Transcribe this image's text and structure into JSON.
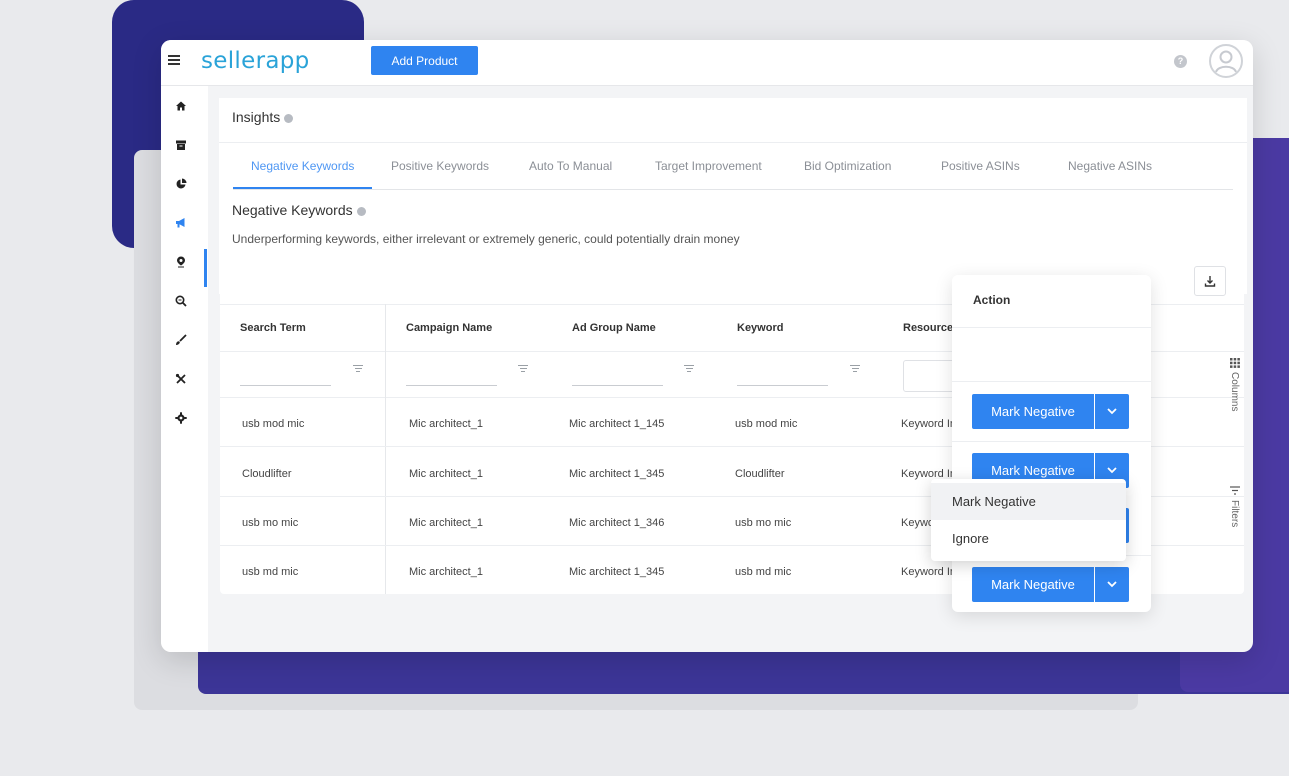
{
  "header": {
    "logo_text": "sellerapp",
    "add_product_label": "Add Product",
    "help_label": "?"
  },
  "sidebar": {
    "items": [
      {
        "icon": "home-icon",
        "glyph": "⌂"
      },
      {
        "icon": "archive-icon",
        "glyph": "▬"
      },
      {
        "icon": "pie-chart-icon",
        "glyph": "◕"
      },
      {
        "icon": "megaphone-icon",
        "glyph": "◢"
      },
      {
        "icon": "location-pin-icon",
        "glyph": "⚲"
      },
      {
        "icon": "search-icon",
        "glyph": "⊕"
      },
      {
        "icon": "brush-icon",
        "glyph": "✎"
      },
      {
        "icon": "tools-icon",
        "glyph": "✕"
      },
      {
        "icon": "settings-gear-icon",
        "glyph": "✹"
      }
    ],
    "active_index": 3
  },
  "insights": {
    "title": "Insights",
    "tabs": [
      "Negative Keywords",
      "Positive Keywords",
      "Auto To Manual",
      "Target Improvement",
      "Bid Optimization",
      "Positive ASINs",
      "Negative ASINs"
    ],
    "active_tab": 0,
    "section_title": "Negative Keywords",
    "section_description": "Underperforming keywords, either irrelevant or extremely generic, could potentially drain money"
  },
  "table": {
    "columns": [
      "Search Term",
      "Campaign Name",
      "Ad Group Name",
      "Keyword",
      "Resource"
    ],
    "rows": [
      {
        "search_term": "usb mod mic",
        "campaign": "Mic architect_1",
        "ad_group": "Mic architect 1_145",
        "keyword": "usb mod mic",
        "resource": "Keyword In"
      },
      {
        "search_term": "Cloudlifter",
        "campaign": "Mic architect_1",
        "ad_group": "Mic architect 1_345",
        "keyword": "Cloudlifter",
        "resource": "Keyword In"
      },
      {
        "search_term": "usb mo mic",
        "campaign": "Mic architect_1",
        "ad_group": "Mic architect 1_346",
        "keyword": "usb mo mic",
        "resource": "Keywo"
      },
      {
        "search_term": "usb md mic",
        "campaign": "Mic architect_1",
        "ad_group": "Mic architect 1_345",
        "keyword": "usb md mic",
        "resource": "Keyword In"
      }
    ],
    "side_tools": {
      "columns_label": "Columns",
      "filters_label": "Filters"
    }
  },
  "action_panel": {
    "title": "Action",
    "button_label": "Mark Negative"
  },
  "dropdown": {
    "items": [
      "Mark Negative",
      "Ignore"
    ],
    "hovered_index": 0
  },
  "colors": {
    "primary": "#2f84f0",
    "brand": "#2aa3d8",
    "decor_navy": "#2a2a85",
    "decor_purple": "#4b3aa3"
  }
}
